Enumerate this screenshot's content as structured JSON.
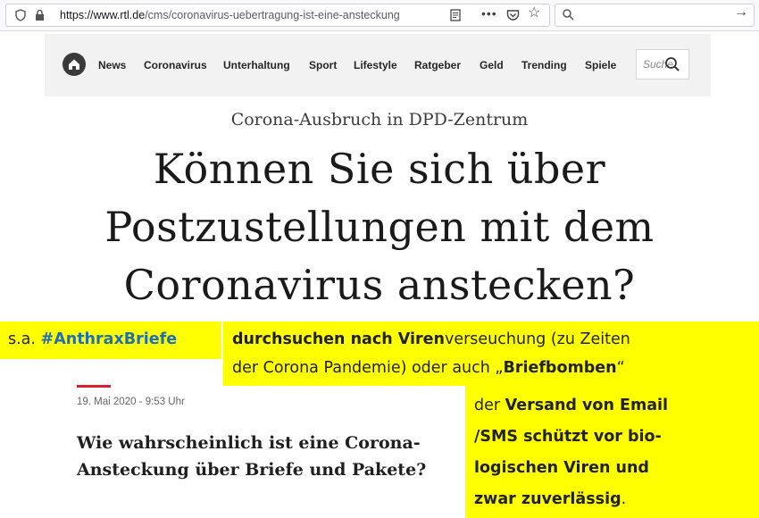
{
  "browser": {
    "url_host": "https://www.rtl.de",
    "url_path": "/cms/coronavirus-uebertragung-ist-eine-ansteckung"
  },
  "nav": {
    "items": [
      "News",
      "Coronavirus",
      "Unterhaltung",
      "Sport",
      "Lifestyle",
      "Ratgeber",
      "Geld",
      "Trending",
      "Spiele"
    ],
    "search_placeholder": "Suche"
  },
  "article": {
    "kicker": "Corona-Ausbruch in DPD-Zentrum",
    "headline_lines": [
      "Können Sie sich über",
      "Postzustellungen mit dem",
      "Coronavirus anstecken?"
    ],
    "date": "19. Mai 2020 - 9:53 Uhr",
    "subhead_lines": [
      "Wie wahrscheinlich ist eine Corona-",
      "Ansteckung über Briefe und Pakete?"
    ]
  },
  "annotations": {
    "box1_prefix": "s.a. ",
    "box1_tag": "#AnthraxBriefe",
    "box2_bold1": "durchsuchen nach Viren",
    "box2_rest1": "verseuchung  (zu Zeiten",
    "box2_line2_a": "der Corona Pandemie) oder auch „",
    "box2_bold2": "Briefbomben",
    "box2_line2_b": "“",
    "box3_l1a": "der  ",
    "box3_l1b": "Versand von Email",
    "box3_l2": "/SMS schützt vor bio-",
    "box3_l3": "logischen Viren und",
    "box3_l4a": "zwar zuverlässig",
    "box3_l4b": "."
  },
  "colors": {
    "highlight": "#ffff00",
    "hashtag": "#1f6fb5",
    "accent_red": "#dd1e2d"
  }
}
